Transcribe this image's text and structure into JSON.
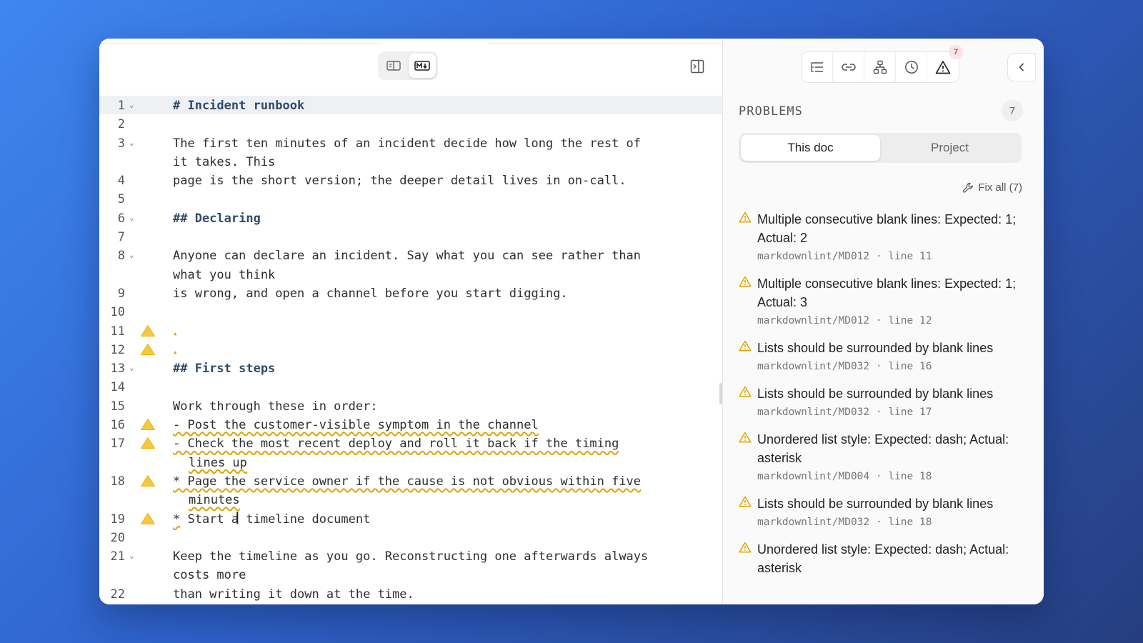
{
  "editor": {
    "lines": [
      {
        "n": "1",
        "fold": true,
        "warn": false,
        "active": true,
        "parts": [
          {
            "t": "# Incident runbook",
            "c": "hdr"
          }
        ]
      },
      {
        "n": "2",
        "fold": false,
        "warn": false,
        "parts": []
      },
      {
        "n": "3",
        "fold": true,
        "warn": false,
        "parts": [
          {
            "t": "The first ten minutes of an incident decide how long the rest of"
          }
        ]
      },
      {
        "n": "",
        "fold": false,
        "warn": false,
        "parts": [
          {
            "t": "it takes. This"
          }
        ]
      },
      {
        "n": "4",
        "fold": false,
        "warn": false,
        "parts": [
          {
            "t": "page is the short version; the deeper detail lives in on-call."
          }
        ]
      },
      {
        "n": "5",
        "fold": false,
        "warn": false,
        "parts": []
      },
      {
        "n": "6",
        "fold": true,
        "warn": false,
        "parts": [
          {
            "t": "## Declaring",
            "c": "hdr"
          }
        ]
      },
      {
        "n": "7",
        "fold": false,
        "warn": false,
        "parts": []
      },
      {
        "n": "8",
        "fold": true,
        "warn": false,
        "parts": [
          {
            "t": "Anyone can declare an incident. Say what you can see rather than"
          }
        ]
      },
      {
        "n": "",
        "fold": false,
        "warn": false,
        "parts": [
          {
            "t": "what you think"
          }
        ]
      },
      {
        "n": "9",
        "fold": false,
        "warn": false,
        "parts": [
          {
            "t": "is wrong, and open a channel before you start digging."
          }
        ]
      },
      {
        "n": "10",
        "fold": false,
        "warn": false,
        "parts": []
      },
      {
        "n": "11",
        "fold": false,
        "warn": true,
        "caret": true,
        "parts": []
      },
      {
        "n": "12",
        "fold": false,
        "warn": true,
        "caret": true,
        "parts": []
      },
      {
        "n": "13",
        "fold": true,
        "warn": false,
        "parts": [
          {
            "t": "## First steps",
            "c": "hdr"
          }
        ]
      },
      {
        "n": "14",
        "fold": false,
        "warn": false,
        "parts": []
      },
      {
        "n": "15",
        "fold": false,
        "warn": false,
        "parts": [
          {
            "t": "Work through these in order:"
          }
        ]
      },
      {
        "n": "16",
        "fold": false,
        "warn": true,
        "parts": [
          {
            "t": "- Post the customer-visible symptom in the channel",
            "c": "squig"
          }
        ]
      },
      {
        "n": "17",
        "fold": false,
        "warn": true,
        "parts": [
          {
            "t": "- Check the most recent deploy and roll it back if the timing",
            "c": "squig"
          }
        ]
      },
      {
        "n": "",
        "fold": false,
        "warn": false,
        "indent": true,
        "parts": [
          {
            "t": "lines up",
            "c": "squig"
          }
        ]
      },
      {
        "n": "18",
        "fold": false,
        "warn": true,
        "parts": [
          {
            "t": "* Page the service owner if the cause is not obvious within five",
            "c": "squig"
          }
        ]
      },
      {
        "n": "",
        "fold": false,
        "warn": false,
        "indent": true,
        "parts": [
          {
            "t": "minutes",
            "c": "squig"
          }
        ]
      },
      {
        "n": "19",
        "fold": false,
        "warn": true,
        "parts": [
          {
            "t": "*",
            "c": "squig"
          },
          {
            "t": " Start a timeline document"
          }
        ]
      },
      {
        "n": "20",
        "fold": false,
        "warn": false,
        "parts": []
      },
      {
        "n": "21",
        "fold": true,
        "warn": false,
        "parts": [
          {
            "t": "Keep the timeline as you go. Reconstructing one afterwards always"
          }
        ]
      },
      {
        "n": "",
        "fold": false,
        "warn": false,
        "parts": [
          {
            "t": "costs more"
          }
        ]
      },
      {
        "n": "22",
        "fold": false,
        "warn": false,
        "parts": [
          {
            "t": "than writing it down at the time."
          }
        ]
      }
    ]
  },
  "panel": {
    "badge_count": "7",
    "title": "PROBLEMS",
    "count": "7",
    "tabs": {
      "this_doc": "This doc",
      "project": "Project"
    },
    "fix_all": "Fix all (7)",
    "problems": [
      {
        "message": "Multiple consecutive blank lines: Expected: 1; Actual: 2",
        "meta": "markdownlint/MD012 · line 11"
      },
      {
        "message": "Multiple consecutive blank lines: Expected: 1; Actual: 3",
        "meta": "markdownlint/MD012 · line 12"
      },
      {
        "message": "Lists should be surrounded by blank lines",
        "meta": "markdownlint/MD032 · line 16"
      },
      {
        "message": "Lists should be surrounded by blank lines",
        "meta": "markdownlint/MD032 · line 17"
      },
      {
        "message": "Unordered list style: Expected: dash; Actual: asterisk",
        "meta": "markdownlint/MD004 · line 18"
      },
      {
        "message": "Lists should be surrounded by blank lines",
        "meta": "markdownlint/MD032 · line 18"
      },
      {
        "message": "Unordered list style: Expected: dash; Actual: asterisk",
        "meta": ""
      }
    ]
  },
  "colors": {
    "warning": "#e0a400",
    "badge": "#e04444",
    "heading": "#2f4a6b"
  }
}
